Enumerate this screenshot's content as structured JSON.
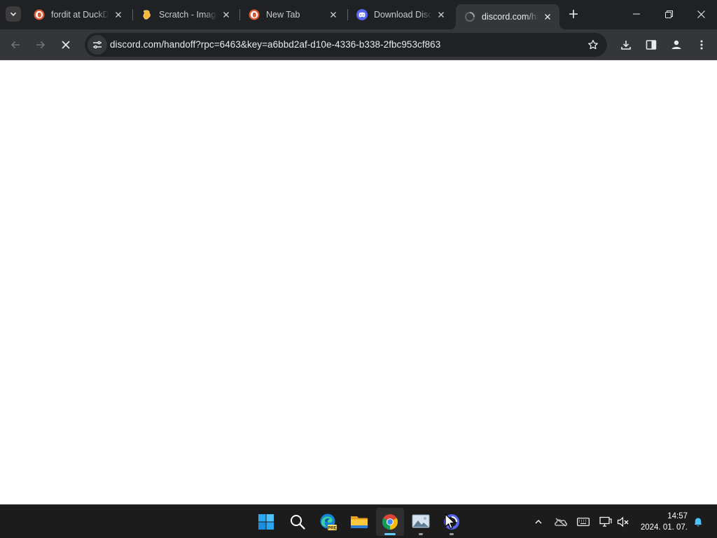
{
  "browser": {
    "tabs": [
      {
        "title": "fordit at DuckDuckGo",
        "favicon": "duckduckgo-icon",
        "active": false
      },
      {
        "title": "Scratch - Imagine, Program, Share",
        "favicon": "scratch-icon",
        "active": false
      },
      {
        "title": "New Tab",
        "favicon": "duckduckgo-icon",
        "active": false
      },
      {
        "title": "Download Discord",
        "favicon": "discord-icon",
        "active": false
      },
      {
        "title": "discord.com/handoff",
        "favicon": "loading-icon",
        "active": true
      }
    ],
    "address_bar": {
      "url": "discord.com/handoff?rpc=6463&key=a6bbd2af-d10e-4336-b338-2fbc953cf863"
    },
    "loading": true
  },
  "taskbar": {
    "apps": [
      {
        "name": "start",
        "icon": "windows-start-icon"
      },
      {
        "name": "search",
        "icon": "search-icon"
      },
      {
        "name": "edge-preview",
        "icon": "edge-pre-icon",
        "badge": "PRE"
      },
      {
        "name": "file-explorer",
        "icon": "folder-icon"
      },
      {
        "name": "chrome",
        "icon": "chrome-icon",
        "active": true
      },
      {
        "name": "photos",
        "icon": "photos-icon"
      },
      {
        "name": "discord-installer",
        "icon": "discord-installer-icon"
      }
    ],
    "tray": [
      "chevron-up-icon",
      "onedrive-icon",
      "keyboard-icon",
      "display-icon",
      "volume-muted-icon"
    ],
    "clock": {
      "time": "14:57",
      "date": "2024. 01. 07."
    }
  },
  "colors": {
    "tabstrip_bg": "#202124",
    "toolbar_bg": "#35363a",
    "omnibox_bg": "#202124",
    "taskbar_bg": "#1c1c1c",
    "accent": "#60cdff",
    "discord_blurple": "#5865f2"
  }
}
